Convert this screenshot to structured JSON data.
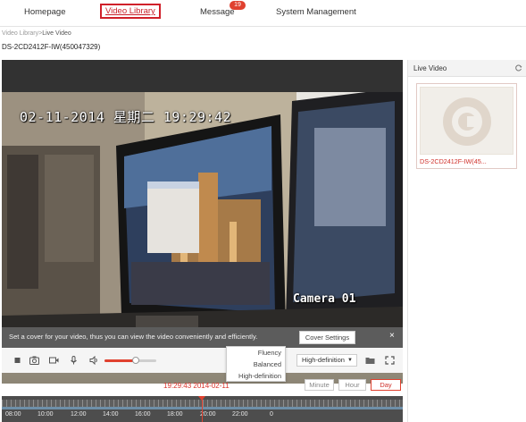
{
  "nav": {
    "items": [
      "Homepage",
      "Video Library",
      "Message",
      "System Management"
    ],
    "message_badge": "19"
  },
  "breadcrumb": {
    "parent": "Video Library",
    "separator": ">",
    "current": "Live Video"
  },
  "device_title": "DS-2CD2412F-IW(450047329)",
  "video": {
    "osd_datetime": "02-11-2014 星期二 19:29:42",
    "osd_camera": "Camera 01",
    "cover_message": "Set a cover for your video, thus you can view the video conveniently and efficiently.",
    "cover_button": "Cover Settings",
    "close_symbol": "×"
  },
  "controls": {
    "icons": [
      "stop-icon",
      "snapshot-icon",
      "record-icon",
      "microphone-icon",
      "volume-icon"
    ],
    "volume_level": 0.6,
    "quality_selected": "High-definition",
    "quality_options": [
      "Fluency",
      "Balanced",
      "High-definition"
    ],
    "right_icons": [
      "folder-icon",
      "fullscreen-icon"
    ]
  },
  "timeline": {
    "current_time": "19:29:43 2014-02-11",
    "ranges": [
      "Minute",
      "Hour",
      "Day"
    ],
    "active_range": "Day",
    "hour_labels": [
      "08:00",
      "10:00",
      "12:00",
      "14:00",
      "16:00",
      "18:00",
      "20:00",
      "22:00",
      "0"
    ]
  },
  "right_panel": {
    "title": "Live Video",
    "device_label": "DS-2CD2412F-IW(45..."
  },
  "colors": {
    "accent": "#e0412f",
    "highlight_box": "#d0202a",
    "video_bg": "#3a3a3a",
    "timeline_bg": "#4d4d4d"
  }
}
